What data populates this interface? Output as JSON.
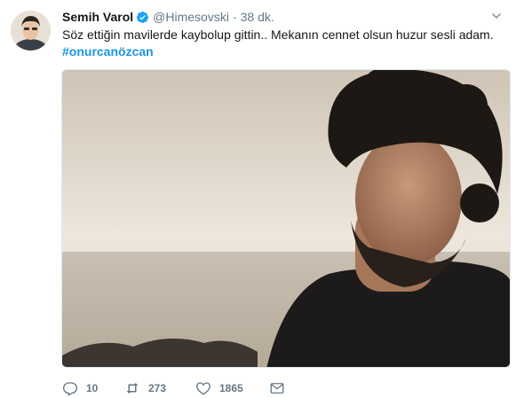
{
  "tweet": {
    "author_name": "Semih Varol",
    "handle": "@Himesovski",
    "separator": "·",
    "time": "38 dk.",
    "text": "Söz ettiğin mavilerde kaybolup gittin.. Mekanın cennet olsun huzur sesli adam.",
    "hashtag": "#onurcanözcan"
  },
  "actions": {
    "replies": "10",
    "retweets": "273",
    "likes": "1865"
  },
  "icons": {
    "avatar": "avatar",
    "verified": "verified-badge-icon",
    "menu": "chevron-down-icon",
    "reply": "reply-icon",
    "retweet": "retweet-icon",
    "like": "heart-icon",
    "message": "envelope-icon"
  },
  "colors": {
    "link": "#1b95e0",
    "muted": "#657786",
    "text": "#14171a"
  }
}
